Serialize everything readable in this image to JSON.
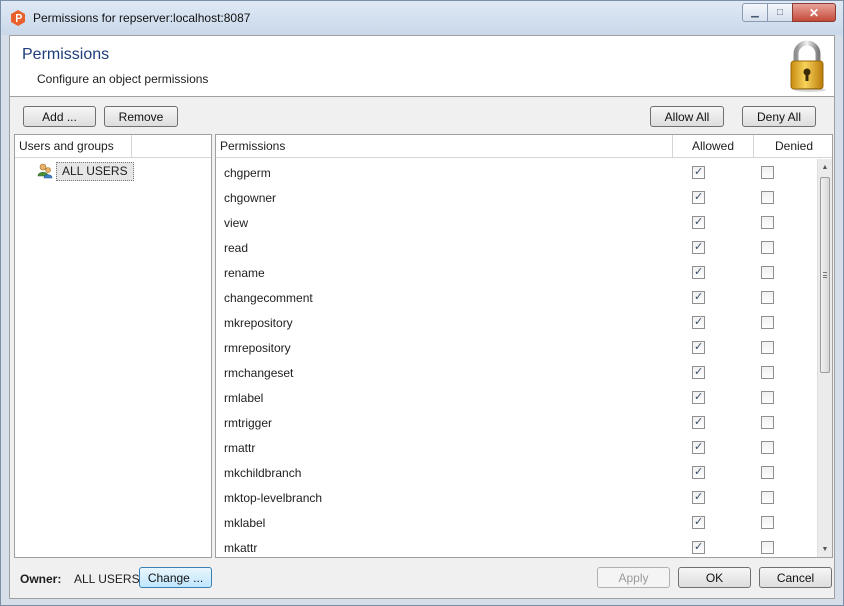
{
  "window": {
    "title": "Permissions for repserver:localhost:8087",
    "controls": [
      "minimize",
      "maximize",
      "close"
    ]
  },
  "header": {
    "title": "Permissions",
    "subtitle": "Configure an object permissions"
  },
  "toolbar": {
    "add_label": "Add ...",
    "remove_label": "Remove",
    "allow_all_label": "Allow All",
    "deny_all_label": "Deny All"
  },
  "users_panel": {
    "header": "Users and groups",
    "items": [
      {
        "label": "ALL USERS",
        "icon": "users-group-icon"
      }
    ]
  },
  "permissions_panel": {
    "headers": {
      "name": "Permissions",
      "allowed": "Allowed",
      "denied": "Denied"
    },
    "rows": [
      {
        "name": "chgperm",
        "allowed": true,
        "denied": false
      },
      {
        "name": "chgowner",
        "allowed": true,
        "denied": false
      },
      {
        "name": "view",
        "allowed": true,
        "denied": false
      },
      {
        "name": "read",
        "allowed": true,
        "denied": false
      },
      {
        "name": "rename",
        "allowed": true,
        "denied": false
      },
      {
        "name": "changecomment",
        "allowed": true,
        "denied": false
      },
      {
        "name": "mkrepository",
        "allowed": true,
        "denied": false
      },
      {
        "name": "rmrepository",
        "allowed": true,
        "denied": false
      },
      {
        "name": "rmchangeset",
        "allowed": true,
        "denied": false
      },
      {
        "name": "rmlabel",
        "allowed": true,
        "denied": false
      },
      {
        "name": "rmtrigger",
        "allowed": true,
        "denied": false
      },
      {
        "name": "rmattr",
        "allowed": true,
        "denied": false
      },
      {
        "name": "mkchildbranch",
        "allowed": true,
        "denied": false
      },
      {
        "name": "mktop-levelbranch",
        "allowed": true,
        "denied": false
      },
      {
        "name": "mklabel",
        "allowed": true,
        "denied": false
      },
      {
        "name": "mkattr",
        "allowed": true,
        "denied": false
      }
    ]
  },
  "footer": {
    "owner_label": "Owner:",
    "owner_value": "ALL USERS",
    "change_label": "Change ...",
    "apply_label": "Apply",
    "ok_label": "OK",
    "cancel_label": "Cancel"
  },
  "colors": {
    "header_title": "#1e3d7a",
    "focus_border": "#3c7fb1",
    "close_button": "#c44a3a"
  }
}
